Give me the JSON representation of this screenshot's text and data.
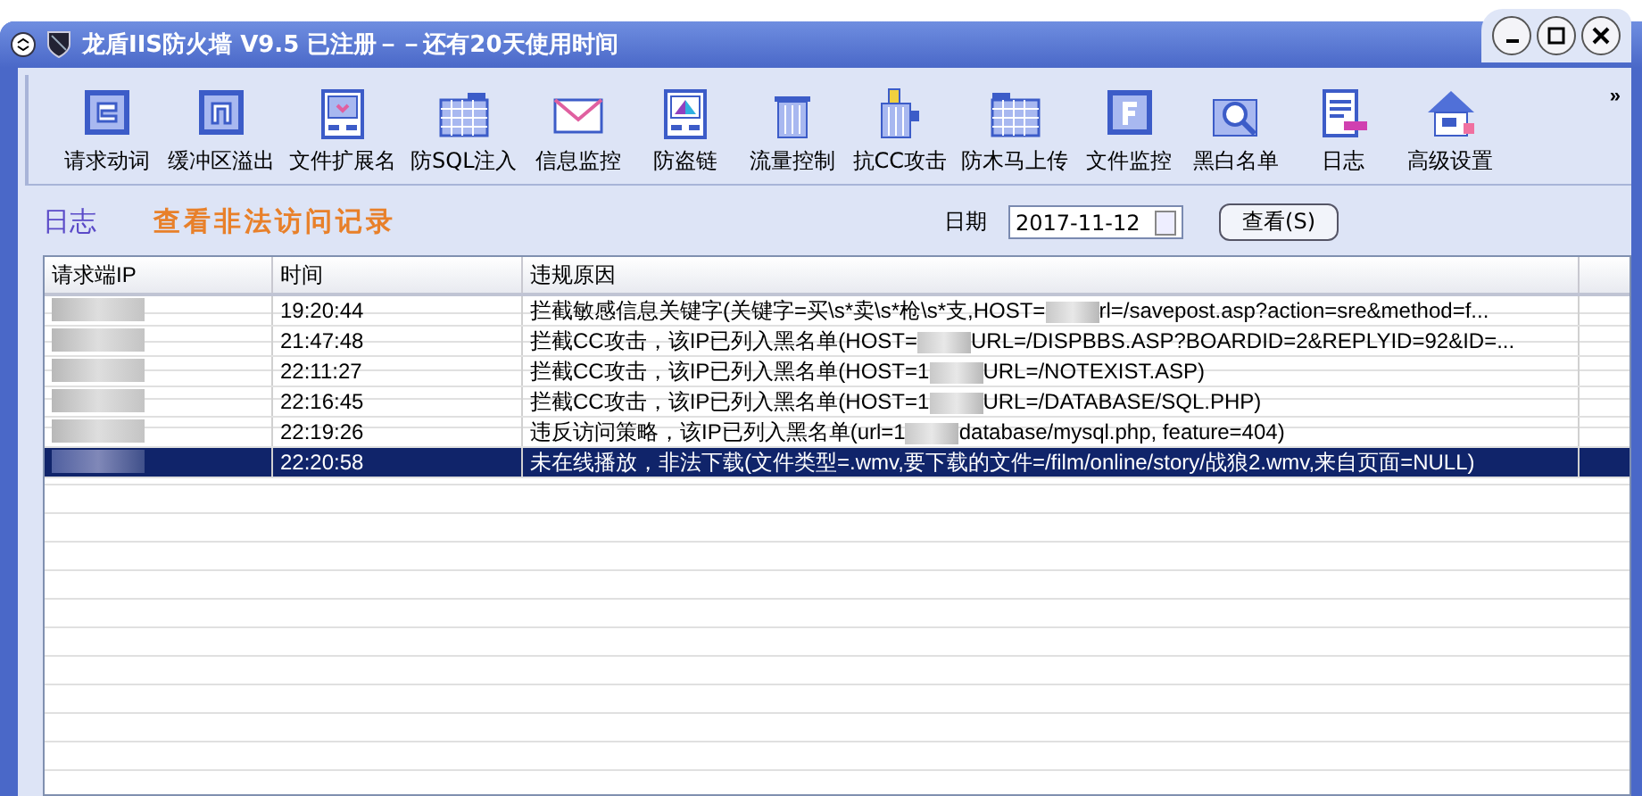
{
  "window": {
    "title": "龙盾IIS防火墙 V9.5 已注册－－还有20天使用时间"
  },
  "toolbar": {
    "items": [
      {
        "label": "请求动词"
      },
      {
        "label": "缓冲区溢出"
      },
      {
        "label": "文件扩展名"
      },
      {
        "label": "防SQL注入"
      },
      {
        "label": "信息监控"
      },
      {
        "label": "防盗链"
      },
      {
        "label": "流量控制"
      },
      {
        "label": "抗CC攻击"
      },
      {
        "label": "防木马上传"
      },
      {
        "label": "文件监控"
      },
      {
        "label": "黑白名单"
      },
      {
        "label": "日志"
      },
      {
        "label": "高级设置"
      }
    ],
    "overflow": "»"
  },
  "header": {
    "section": "日志",
    "subtitle": "查看非法访问记录",
    "date_label": "日期",
    "date_value": "2017-11-12",
    "view_button": "查看(S)"
  },
  "table": {
    "columns": [
      "请求端IP",
      "时间",
      "违规原因"
    ],
    "rows": [
      {
        "time": "19:20:44",
        "reason_start": "拦截敏感信息关键字(关键字=买\\s*卖\\s*枪\\s*支,HOST=",
        "reason_end": "rl=/savepost.asp?action=sre&method=f...",
        "selected": false
      },
      {
        "time": "21:47:48",
        "reason_start": "拦截CC攻击，该IP已列入黑名单(HOST=",
        "reason_end": "URL=/DISPBBS.ASP?BOARDID=2&REPLYID=92&ID=...",
        "selected": false
      },
      {
        "time": "22:11:27",
        "reason_start": "拦截CC攻击，该IP已列入黑名单(HOST=1",
        "reason_end": "URL=/NOTEXIST.ASP)",
        "selected": false
      },
      {
        "time": "22:16:45",
        "reason_start": "拦截CC攻击，该IP已列入黑名单(HOST=1",
        "reason_end": "URL=/DATABASE/SQL.PHP)",
        "selected": false
      },
      {
        "time": "22:19:26",
        "reason_start": "违反访问策略，该IP已列入黑名单(url=1",
        "reason_end": "database/mysql.php, feature=404)",
        "selected": false
      },
      {
        "time": "22:20:58",
        "reason_start": "未在线播放，非法下载(文件类型=.wmv,要下载的文件=/film/online/story/战狼2.wmv,来自页面=NULL)",
        "selected": true
      }
    ]
  }
}
